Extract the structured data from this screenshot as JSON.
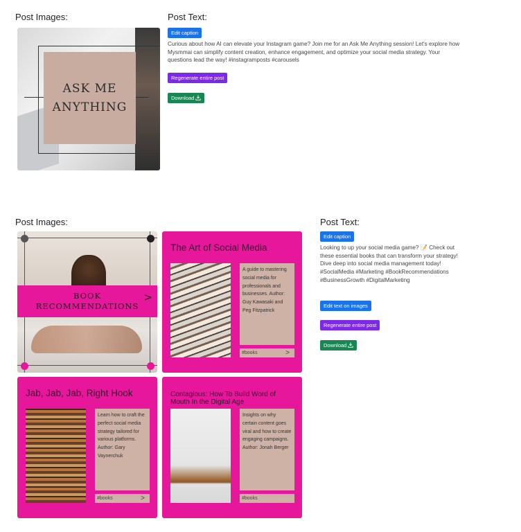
{
  "post1": {
    "images_heading": "Post Images:",
    "text_heading": "Post Text:",
    "edit_caption": "Edit caption",
    "caption": "Curious about how AI can elevate your Instagram game? Join me for an Ask Me Anything session! Let's explore how Mysmmai can simplify content creation, enhance engagement, and optimize your social media strategy. Your questions lead the way! #instagramposts #carousels",
    "regenerate": "Regenerate entire post",
    "download": "Download",
    "image_text_line1": "ASK ME",
    "image_text_line2": "ANYTHING"
  },
  "post2": {
    "images_heading": "Post Images:",
    "text_heading": "Post Text:",
    "edit_caption": "Edit caption",
    "caption": "Looking to up your social media game? 📝 Check out these essential books that can transform your strategy! Dive deep into social media management today! #SocialMedia #Marketing #BookRecommendations #BusinessGrowth #DigitalMarketing",
    "edit_text_on_images": "Edit text on images",
    "regenerate": "Regenerate entire post",
    "download": "Download",
    "cover": {
      "line1": "BOOK",
      "line2": "RECOMMENDATIONS",
      "arrow": ">"
    },
    "cards": [
      {
        "title": "The Art of Social Media",
        "body": "A guide to mastering social media for professionals and businesses. Author: Guy Kawasaki and Peg Fitzpatrick",
        "tag": "#books",
        "arrow": ">"
      },
      {
        "title": "Jab, Jab, Jab, Right Hook",
        "body": "Learn how to craft the perfect social media strategy tailored for various platforms. Author: Gary Vaynerchuk",
        "tag": "#books",
        "arrow": ">"
      },
      {
        "title": "Contagious: How To Build Word of Mouth In the Digital Age",
        "body": "Insights on why certain content goes viral and how to create engaging campaigns. Author: Jonah Berger",
        "tag": "#books",
        "arrow": ""
      }
    ]
  },
  "colors": {
    "blue_button": "#1a73e8",
    "purple_button": "#7d2ae8",
    "green_button": "#198754",
    "card_pink": "#e6179b",
    "card_box": "#cfb2a6"
  },
  "icons": {
    "download": "download-icon"
  }
}
